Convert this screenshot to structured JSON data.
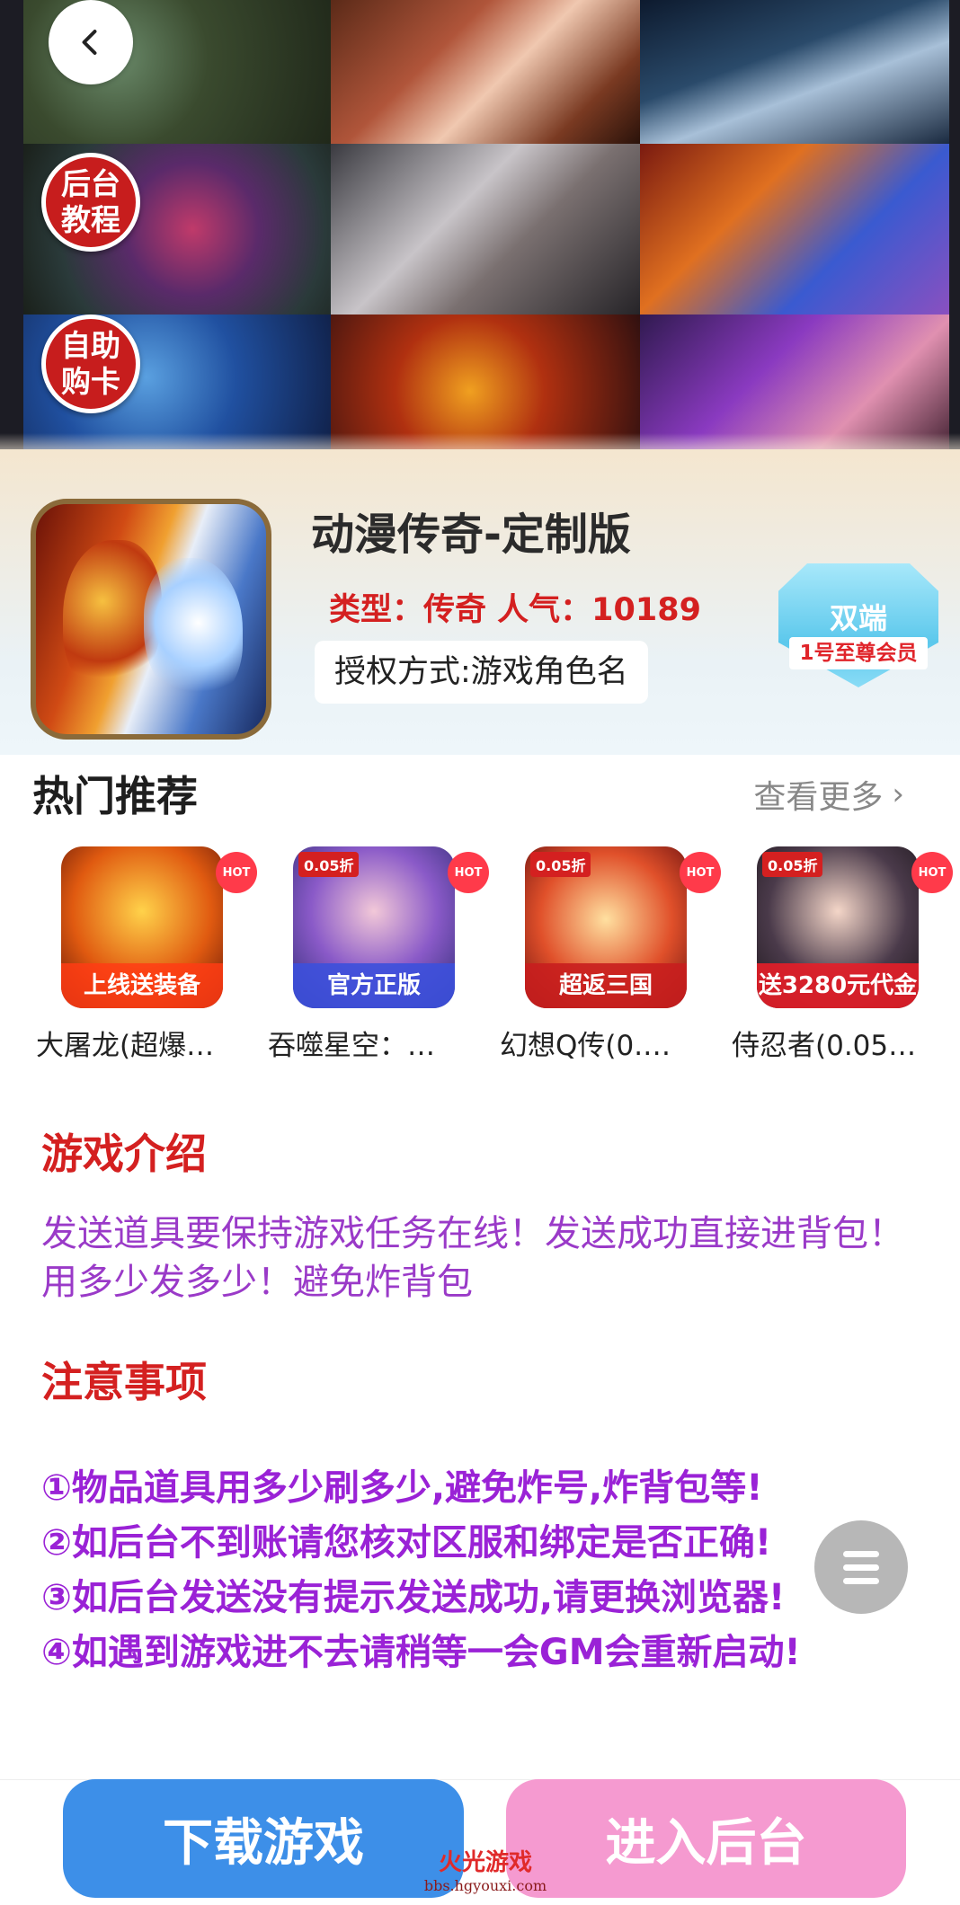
{
  "hero": {
    "badges": [
      "后台\n教程",
      "自助\n购卡"
    ],
    "screenshots": [
      "game-scene-1",
      "game-scene-2",
      "game-scene-3",
      "game-scene-4",
      "game-scene-5",
      "game-scene-6",
      "game-scene-7",
      "game-scene-8",
      "game-scene-9"
    ]
  },
  "app": {
    "title": "动漫传奇-定制版",
    "meta": "类型：传奇 人气：10189",
    "auth": "授权方式:游戏角色名",
    "platform_badge": "双端",
    "vip_badge": "1号至尊会员"
  },
  "hot": {
    "heading": "热门推荐",
    "more": "查看更多",
    "items": [
      {
        "name": "大屠龙(超爆…",
        "caption": "上线送装备",
        "tag": "HOT",
        "discount": ""
      },
      {
        "name": "吞噬星空：…",
        "caption": "官方正版",
        "tag": "HOT",
        "discount": "0.05折"
      },
      {
        "name": "幻想Q传(0.…",
        "caption": "超返三国",
        "tag": "HOT",
        "discount": "0.05折"
      },
      {
        "name": "侍忍者(0.05…",
        "caption": "送3280元代金",
        "tag": "HOT",
        "discount": "0.05折"
      }
    ]
  },
  "intro": {
    "heading": "游戏介绍",
    "text": "发送道具要保持游戏任务在线！发送成功直接进背包！用多少发多少！避免炸背包"
  },
  "notes": {
    "heading": "注意事项",
    "items": [
      "①物品道具用多少刷多少,避免炸号,炸背包等!",
      "②如后台不到账请您核对区服和绑定是否正确!",
      "③如后台发送没有提示发送成功,请更换浏览器!",
      "④如遇到游戏进不去请稍等一会GM会重新启动!"
    ]
  },
  "actions": {
    "download": "下载游戏",
    "admin": "进入后台"
  },
  "watermark": {
    "line1": "火光游戏",
    "line2": "bbs.hgyouxi.com"
  },
  "colors": {
    "accent_red": "#d42020",
    "intro_purple": "#9a3ac8",
    "notes_purple": "#9a22d6",
    "download_blue": "#3d8fe8",
    "admin_pink": "#f59ad0"
  }
}
